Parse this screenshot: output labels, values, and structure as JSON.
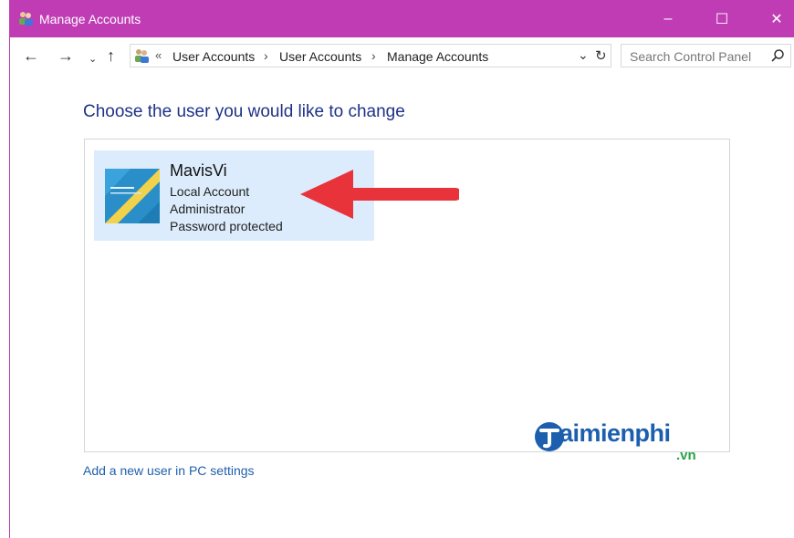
{
  "window": {
    "title": "Manage Accounts",
    "title_icon": "user-accounts-icon",
    "controls": {
      "minimize": "–",
      "maximize": "☐",
      "close": "✕"
    },
    "accent_color": "#bf3cb4"
  },
  "nav": {
    "back_icon": "←",
    "forward_icon": "→",
    "recent_icon": "⌄",
    "up_icon": "↑"
  },
  "address": {
    "overflow": "«",
    "crumbs": [
      "User Accounts",
      "User Accounts",
      "Manage Accounts"
    ],
    "separator": "›",
    "dropdown_icon": "⌄",
    "refresh_icon": "↻"
  },
  "search": {
    "placeholder": "Search Control Panel"
  },
  "main": {
    "heading": "Choose the user you would like to change",
    "user": {
      "name": "MavisVi",
      "lines": [
        "Local Account",
        "Administrator",
        "Password protected"
      ]
    },
    "add_link": "Add a new user in PC settings"
  },
  "watermark": {
    "text": "aimienphi",
    "suffix": ".vn"
  },
  "annotation": {
    "arrow_color": "#e8333b"
  }
}
